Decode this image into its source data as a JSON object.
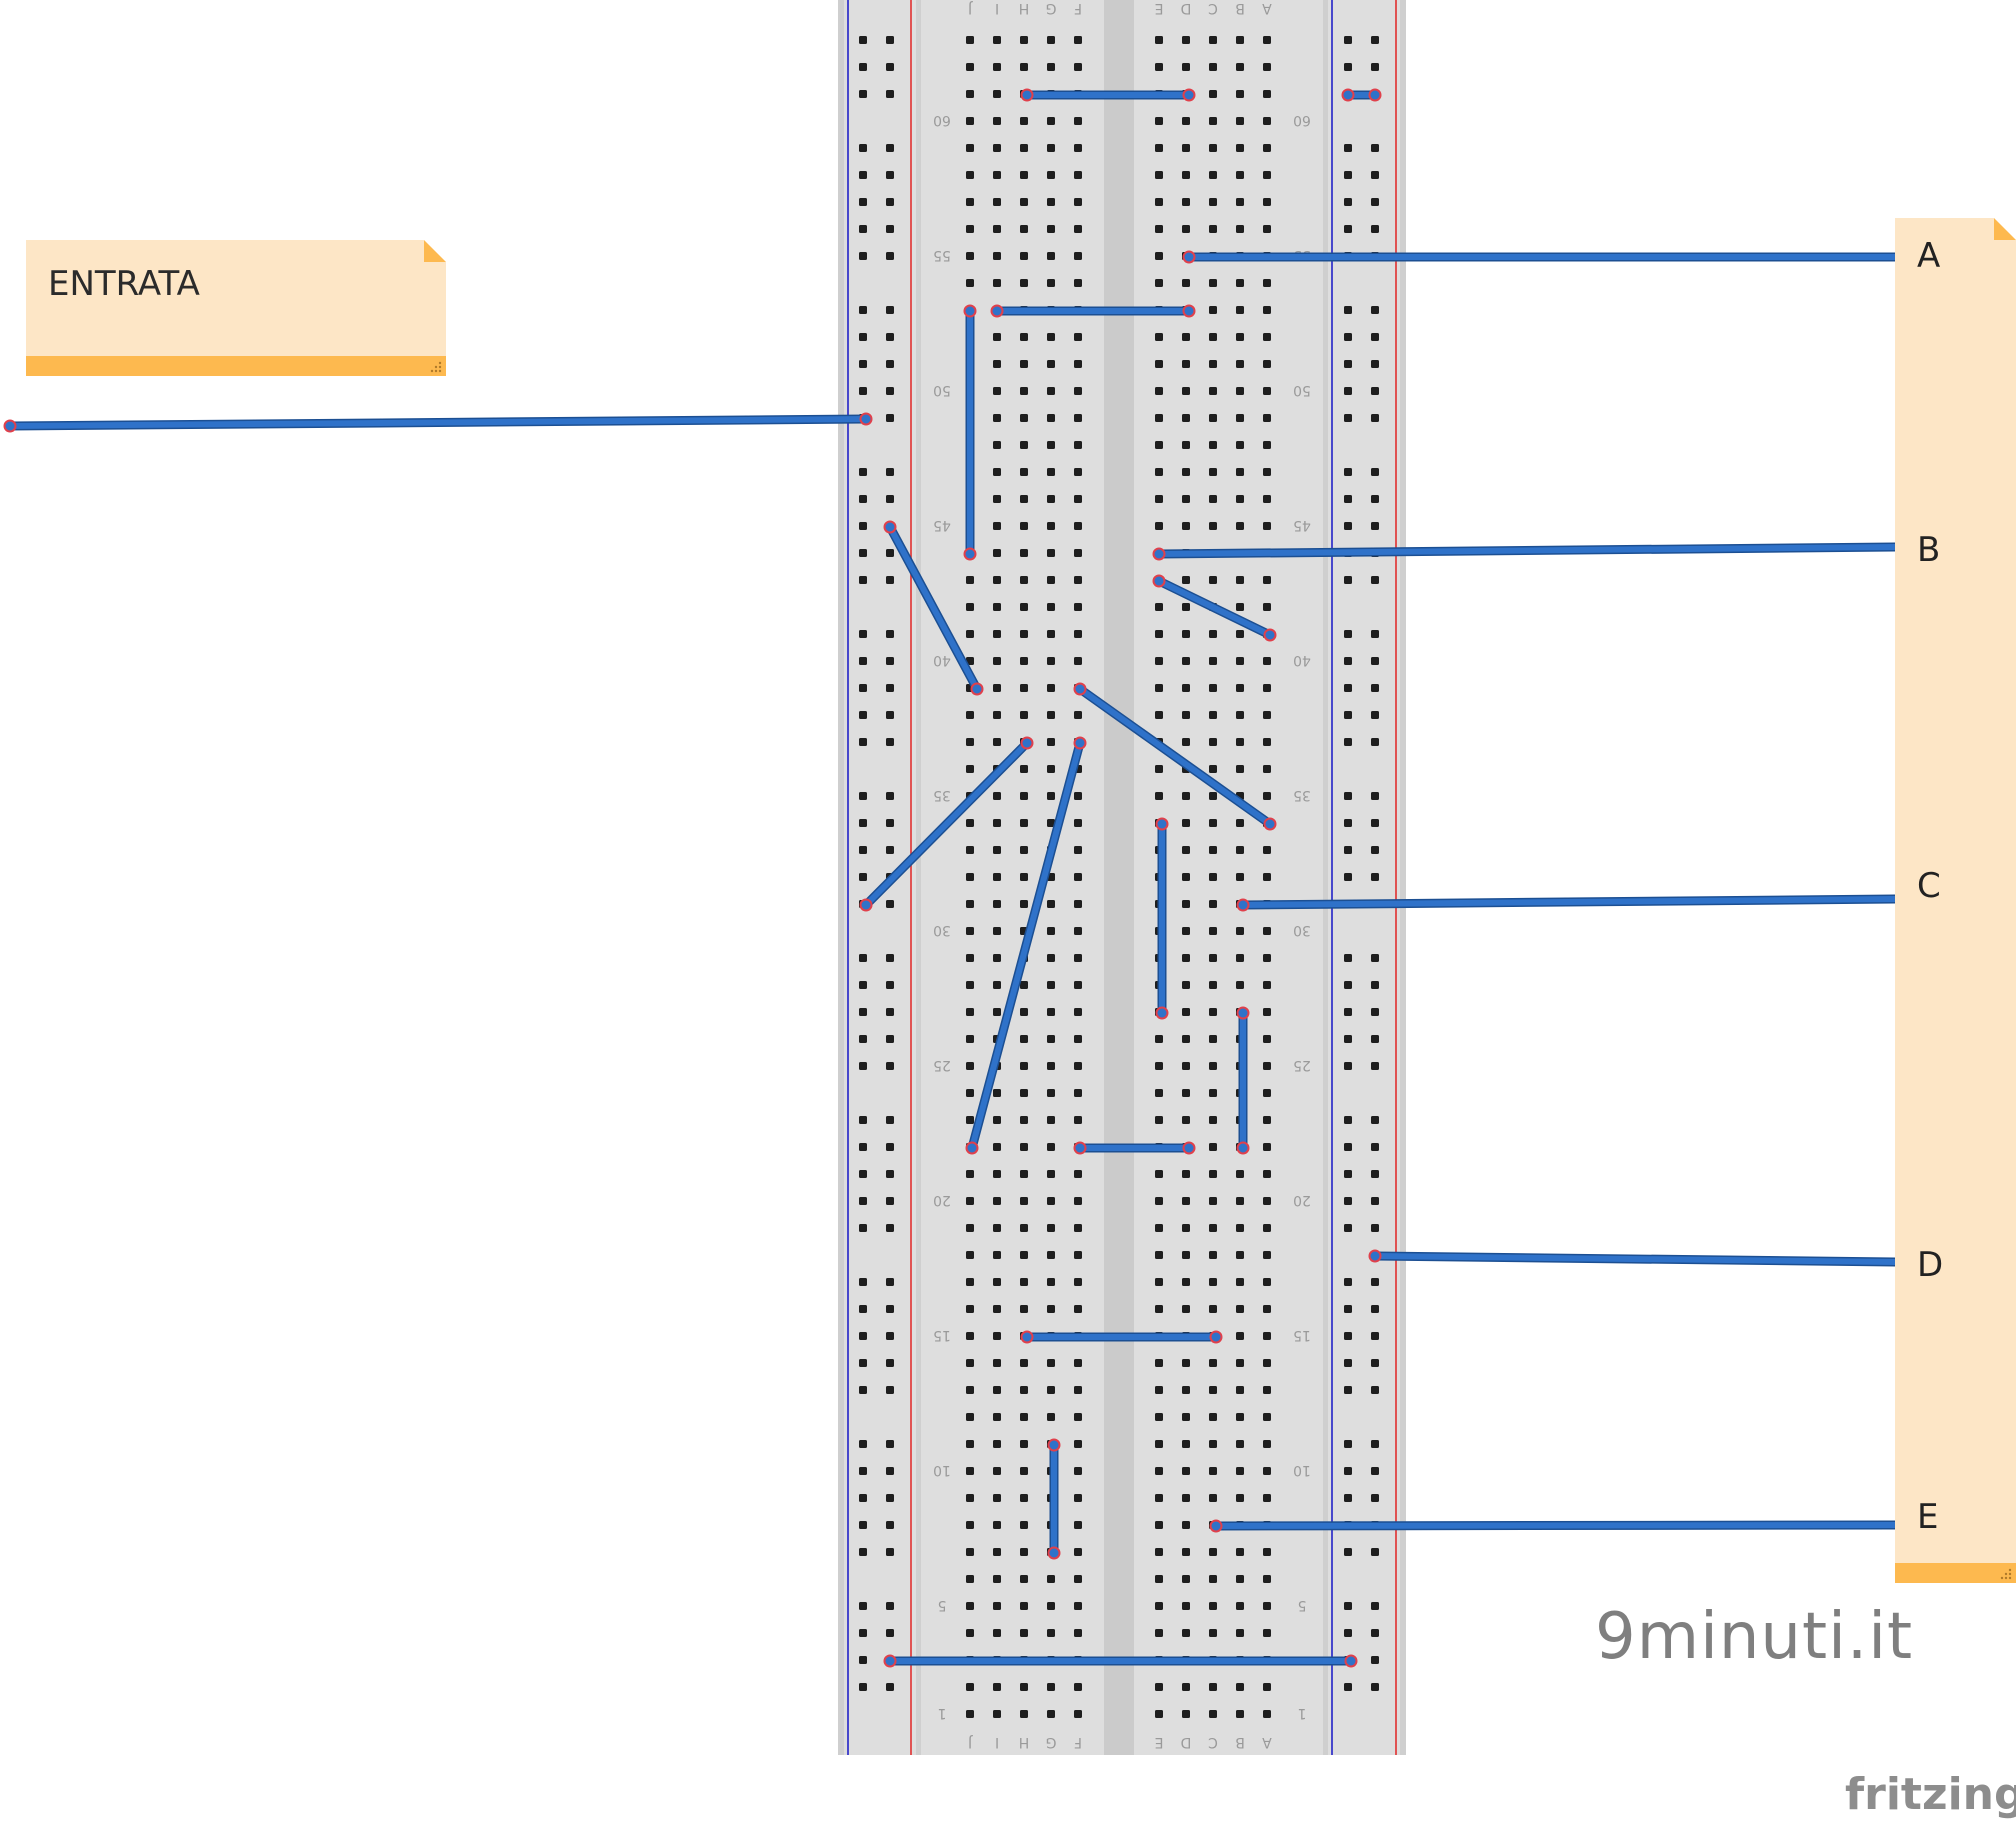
{
  "input_note": {
    "label": "ENTRATA"
  },
  "outputs": [
    "A",
    "B",
    "C",
    "D",
    "E"
  ],
  "breadboard": {
    "columns_left_half": [
      "J",
      "I",
      "H",
      "G",
      "F"
    ],
    "columns_right_half": [
      "E",
      "D",
      "C",
      "B",
      "A"
    ],
    "row_numbers": [
      "60",
      "55",
      "50",
      "45",
      "40",
      "35",
      "30",
      "25",
      "20",
      "15",
      "10",
      "5",
      "1"
    ],
    "rows": 63
  },
  "colors": {
    "board": "#dedede",
    "wire": "#2f72c9",
    "wire_end": "#e0404b",
    "rail_blue": "#2323c8",
    "rail_red": "#e03030",
    "note": "#fde6c6",
    "note_bar": "#fdb94f"
  },
  "watermark": "9minuti.it",
  "brand": "fritzing"
}
